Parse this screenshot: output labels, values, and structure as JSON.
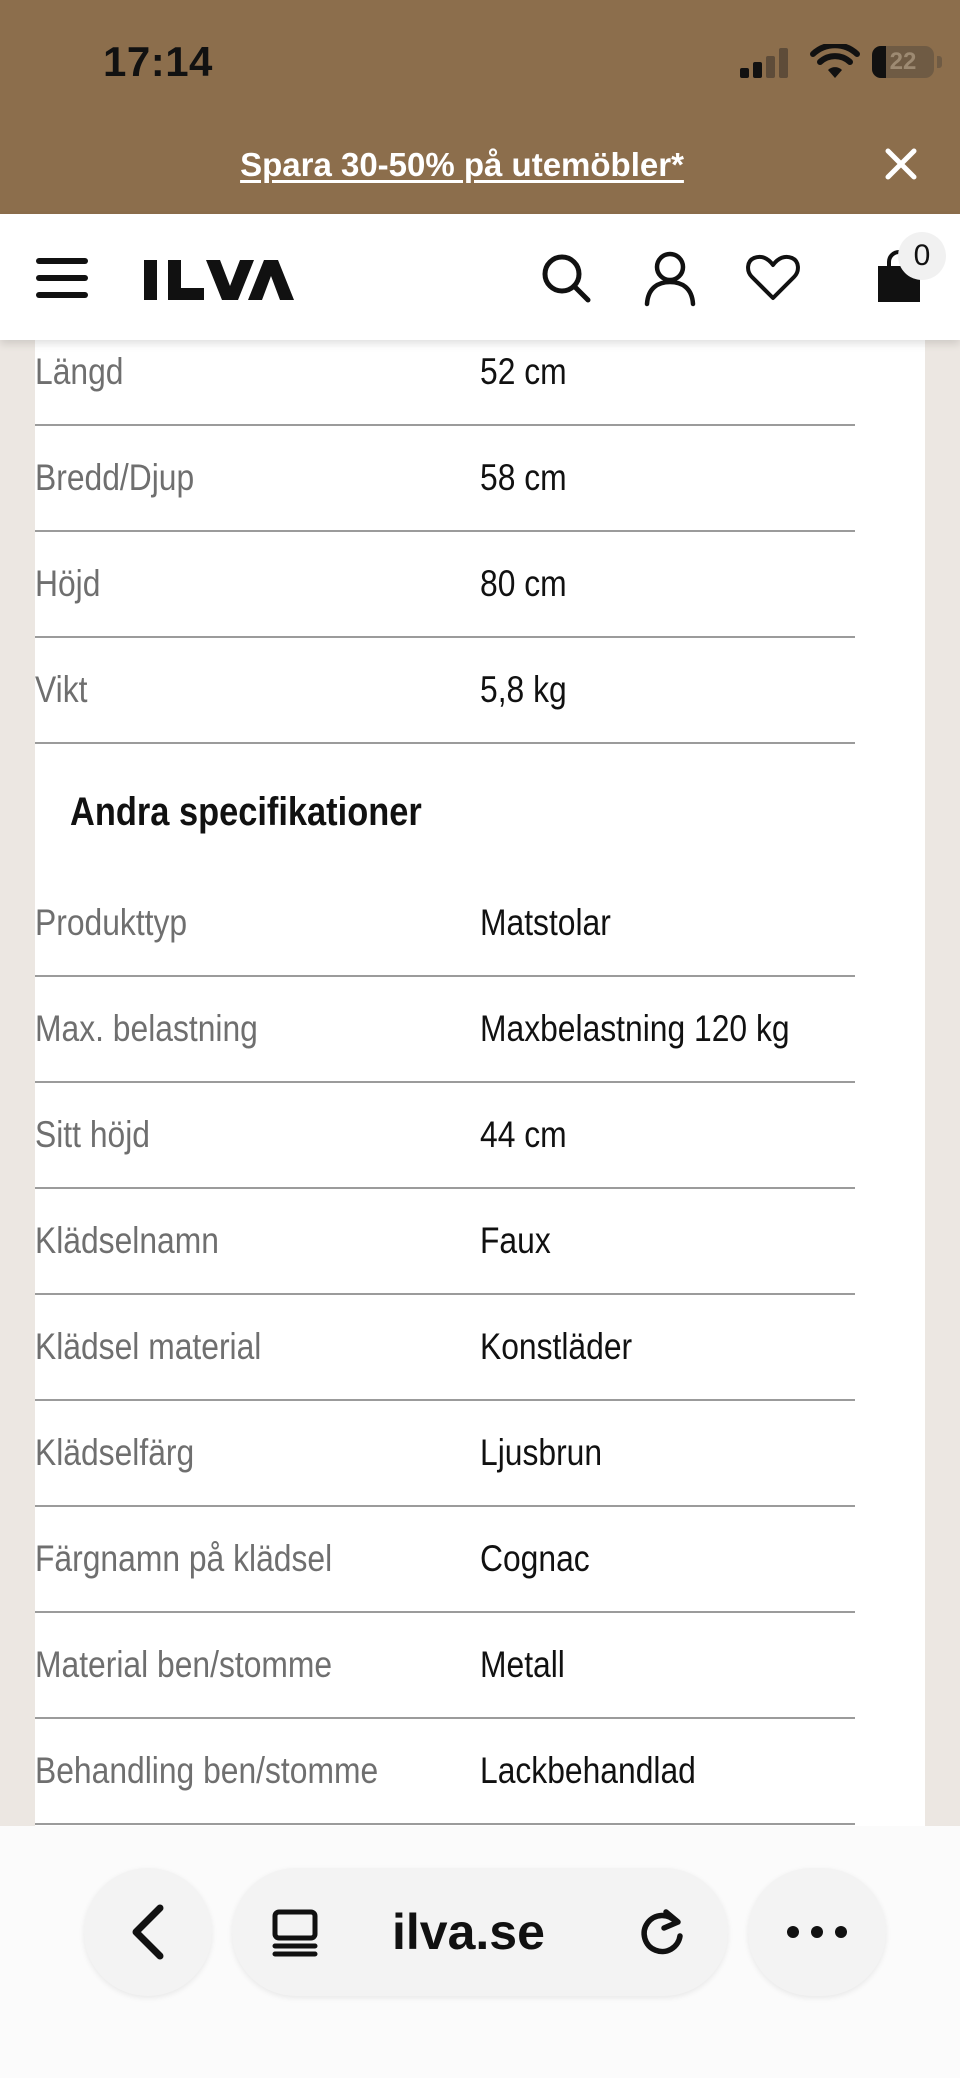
{
  "status_bar": {
    "time": "17:14",
    "battery_level": "22",
    "battery_fraction": 0.22,
    "signal_bars_active": 2,
    "signal_bars_total": 4
  },
  "promo": {
    "text": "Spara 30-50% på utemöbler*",
    "close_icon": "close-icon"
  },
  "header": {
    "logo_text": "ILVA",
    "cart_count": "0",
    "icons": [
      "menu-icon",
      "search-icon",
      "user-icon",
      "heart-icon",
      "shopping-bag-icon"
    ]
  },
  "dimensions": [
    {
      "label": "Längd",
      "value": "52 cm"
    },
    {
      "label": "Bredd/Djup",
      "value": "58 cm"
    },
    {
      "label": "Höjd",
      "value": "80 cm"
    },
    {
      "label": "Vikt",
      "value": "5,8 kg"
    }
  ],
  "other_specs": {
    "heading": "Andra specifikationer",
    "rows": [
      {
        "label": "Produkttyp",
        "value": "Matstolar"
      },
      {
        "label": "Max. belastning",
        "value": "Maxbelastning 120 kg"
      },
      {
        "label": "Sitt höjd",
        "value": "44 cm"
      },
      {
        "label": "Klädselnamn",
        "value": "Faux"
      },
      {
        "label": "Klädsel material",
        "value": "Konstläder"
      },
      {
        "label": "Klädselfärg",
        "value": "Ljusbrun"
      },
      {
        "label": "Färgnamn på klädsel",
        "value": "Cognac"
      },
      {
        "label": "Material ben/stomme",
        "value": "Metall"
      },
      {
        "label": "Behandling ben/stomme",
        "value": "Lackbehandlad"
      }
    ]
  },
  "browser": {
    "url": "ilva.se",
    "icons": [
      "back-chevron-icon",
      "tabs-icon",
      "reload-icon",
      "more-dots-icon"
    ]
  },
  "colors": {
    "brand_brown": "#8c6e4c",
    "page_bg": "#ece7e2",
    "label_gray": "#6f6f6f",
    "divider": "#9b9b9b"
  }
}
